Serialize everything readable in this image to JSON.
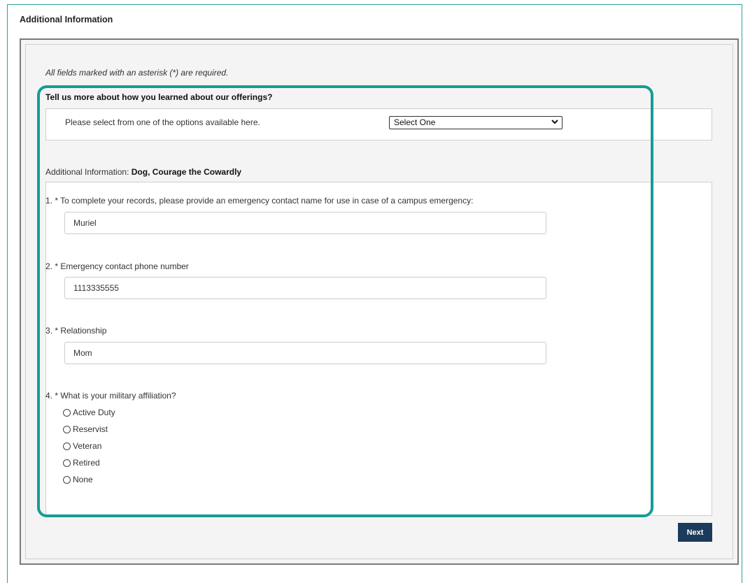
{
  "page": {
    "title": "Additional Information"
  },
  "form": {
    "required_note": "All fields marked with an asterisk (*) are required.",
    "source": {
      "heading": "Tell us more about how you learned about our offerings?",
      "label": "Please select from one of the options available here.",
      "selected": "Select One"
    },
    "student": {
      "prefix": "Additional Information: ",
      "name": "Dog, Courage the Cowardly"
    },
    "questions": [
      {
        "label": "1. * To complete your records, please provide an emergency contact name for use in case of a campus emergency:",
        "value": "Muriel"
      },
      {
        "label": "2. * Emergency contact phone number",
        "value": "1113335555"
      },
      {
        "label": "3. * Relationship",
        "value": "Mom"
      },
      {
        "label": "4. * What is your military affiliation?",
        "options": [
          "Active Duty",
          "Reservist",
          "Veteran",
          "Retired",
          "None"
        ]
      }
    ],
    "next_label": "Next"
  },
  "colors": {
    "highlight": "#149d96",
    "button": "#1b3a5c",
    "frame": "#2aa39a"
  }
}
